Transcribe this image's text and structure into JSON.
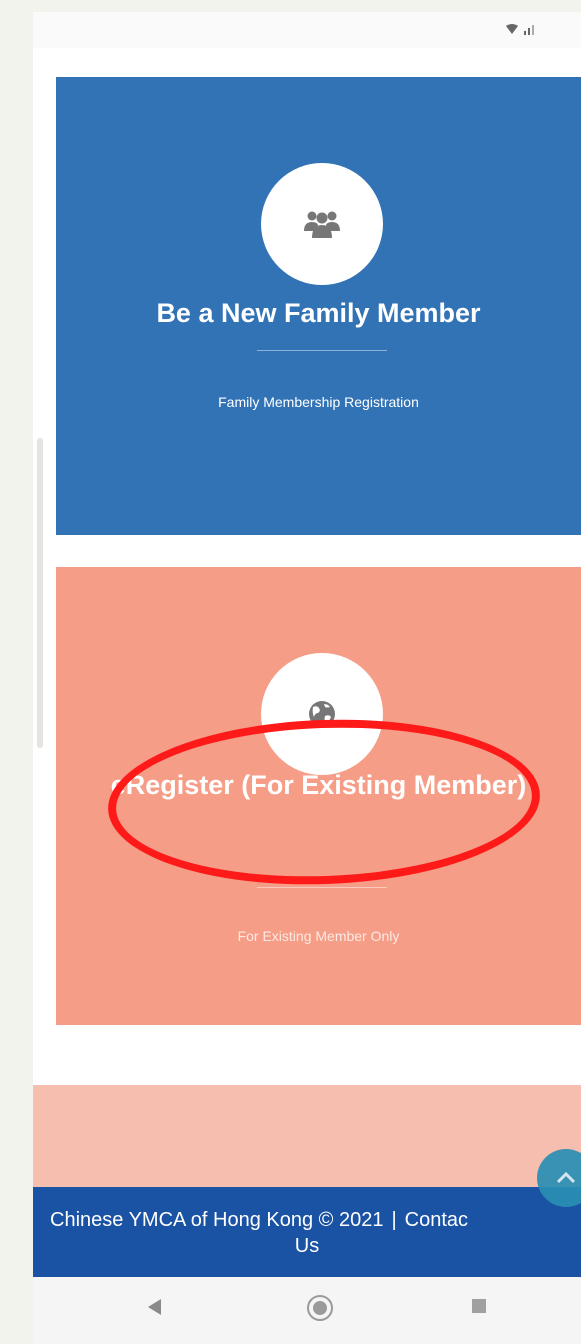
{
  "status_bar": {
    "icons": [
      "wifi-icon",
      "signal-icon"
    ],
    "icons_text": "▾‧∥"
  },
  "cards": [
    {
      "title": "Be a New Family Member",
      "subtitle": "Family Membership Registration",
      "icon": "family-group-icon",
      "color": "#3273b6"
    },
    {
      "title": "eRegister (For Existing Member)",
      "subtitle": "For Existing Member Only",
      "icon": "globe-icon",
      "color": "#f59d87"
    }
  ],
  "annotation": {
    "color": "#ff1a1a"
  },
  "footer": {
    "copyright": "Chinese YMCA of Hong Kong © 2021",
    "separator": "|",
    "contact_part1": "Contac",
    "contact_part2": "Us",
    "background": "#1a52a4"
  },
  "fab": {
    "icon": "chevron-up-icon",
    "color": "#2a8fb5"
  },
  "nav_bar": {
    "buttons": [
      "back-icon",
      "home-icon",
      "recents-icon"
    ]
  }
}
